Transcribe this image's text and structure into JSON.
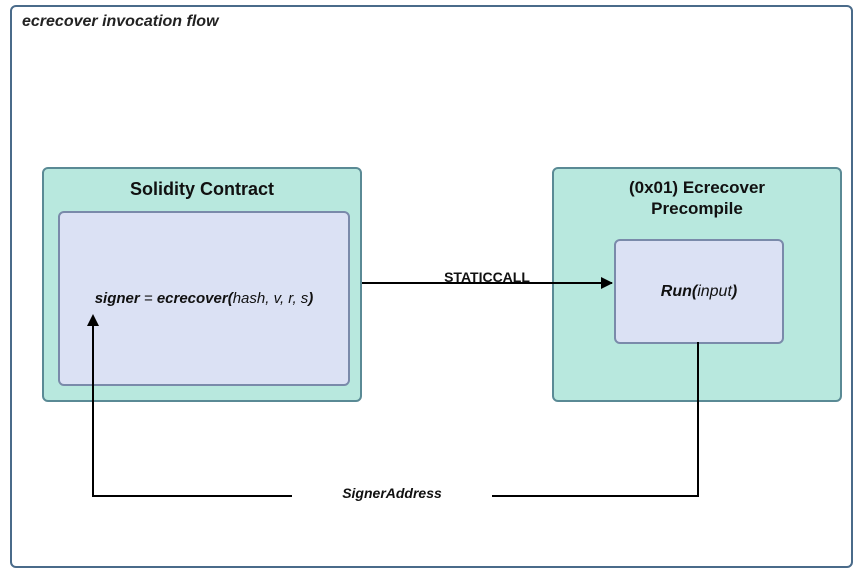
{
  "diagram": {
    "title": "ecrecover invocation flow",
    "contract": {
      "title": "Solidity Contract",
      "code_prefix": "signer",
      "code_eq": " = ",
      "code_fn": "ecrecover(",
      "code_args": "hash, v, r, s",
      "code_close": ")"
    },
    "precompile": {
      "title_line1": "(0x01) Ecrecover",
      "title_line2": "Precompile",
      "code_fn": "Run(",
      "code_args": "input",
      "code_close": ")"
    },
    "call_label": "STATICCALL",
    "return_label": "SignerAddress"
  }
}
